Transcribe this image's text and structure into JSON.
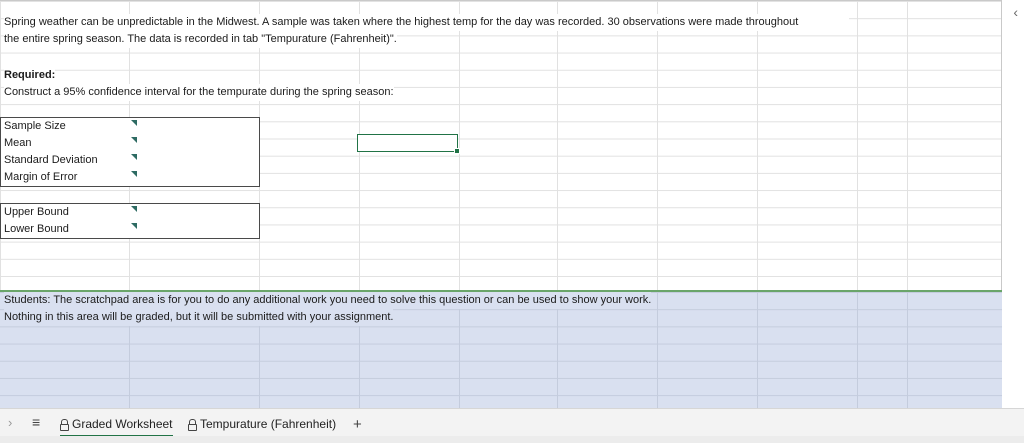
{
  "intro": {
    "line1": "Spring weather can be unpredictable in the Midwest. A sample was taken where the highest temp for the day was recorded. 30 observations were made throughout",
    "line2": "the entire spring season. The data is recorded in tab \"Tempurature (Fahrenheit)\"."
  },
  "required": {
    "heading": "Required:",
    "instruction": "Construct a 95% confidence interval for the tempurate during the spring season:"
  },
  "stats_box": {
    "rows": [
      "Sample Size",
      "Mean",
      "Standard Deviation",
      "Margin of Error"
    ]
  },
  "bounds_box": {
    "rows": [
      "Upper Bound",
      "Lower Bound"
    ]
  },
  "scratchpad": {
    "line1": "Students: The scratchpad area is for you to do any additional work you need to solve this question or can be used to show your work.",
    "line2": "Nothing in this area will be graded, but it will be submitted with your assignment."
  },
  "sheet_tabs": {
    "menu_icon": "hamburger-menu-icon",
    "tabs": [
      {
        "label": "Graded Worksheet",
        "active": true,
        "icon": "lock-icon"
      },
      {
        "label": "Tempurature (Fahrenheit)",
        "active": false,
        "icon": "lock-icon"
      }
    ],
    "add_icon": "plus-icon"
  },
  "colors": {
    "accent_green": "#217346",
    "scratch_fill": "#d9e0f0",
    "comment_marker": "#2e6b63"
  }
}
